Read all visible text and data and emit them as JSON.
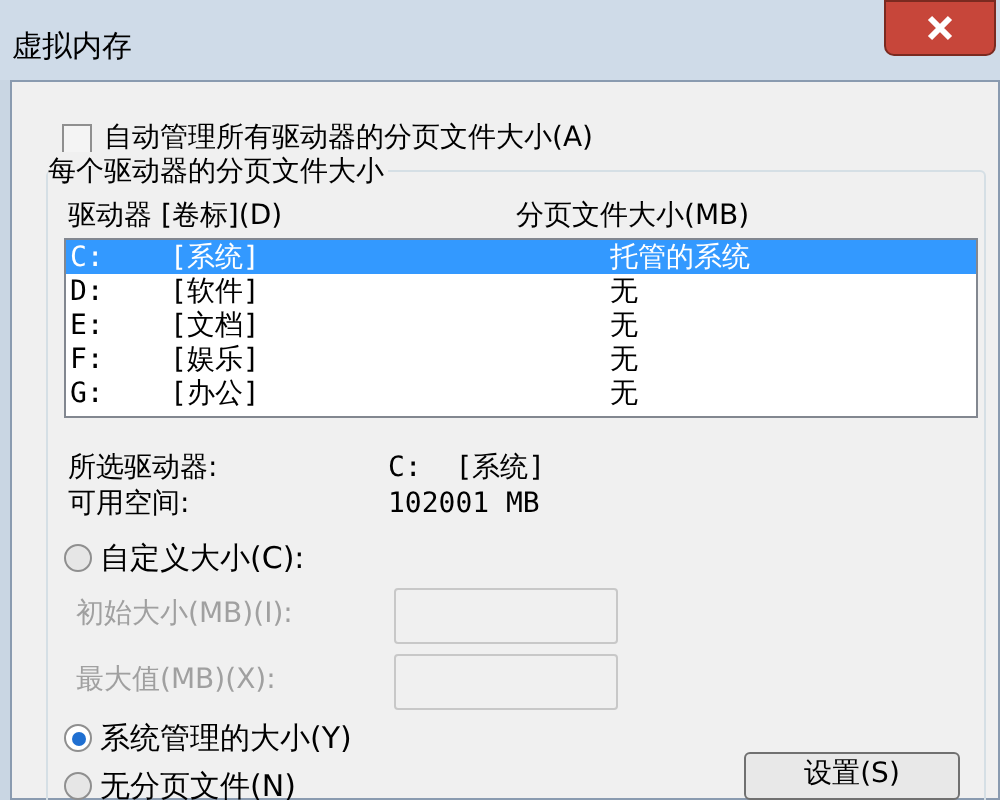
{
  "window": {
    "title": "虚拟内存"
  },
  "auto_manage": {
    "label": "自动管理所有驱动器的分页文件大小(A)",
    "checked": false
  },
  "group": {
    "title": "每个驱动器的分页文件大小",
    "columns": [
      "驱动器 [卷标](D)",
      "分页文件大小(MB)"
    ],
    "drives": [
      {
        "drive": "C:",
        "volume": "[系统]",
        "paging_size": "托管的系统",
        "selected": true
      },
      {
        "drive": "D:",
        "volume": "[软件]",
        "paging_size": "无",
        "selected": false
      },
      {
        "drive": "E:",
        "volume": "[文档]",
        "paging_size": "无",
        "selected": false
      },
      {
        "drive": "F:",
        "volume": "[娱乐]",
        "paging_size": "无",
        "selected": false
      },
      {
        "drive": "G:",
        "volume": "[办公]",
        "paging_size": "无",
        "selected": false
      }
    ],
    "info": [
      {
        "label": "所选驱动器:",
        "value": "C:  [系统]"
      },
      {
        "label": "可用空间:",
        "value": "102001 MB"
      }
    ],
    "options": [
      {
        "kind": "radio",
        "label": "自定义大小(C):",
        "selected": false
      },
      {
        "kind": "field",
        "label": "初始大小(MB)(I):",
        "disabled": true
      },
      {
        "kind": "field",
        "label": "最大值(MB)(X):",
        "disabled": true
      },
      {
        "kind": "radio",
        "label": "系统管理的大小(Y)",
        "selected": true
      },
      {
        "kind": "radio",
        "label": "无分页文件(N)",
        "selected": false
      }
    ],
    "set_button": "设置(S)"
  }
}
